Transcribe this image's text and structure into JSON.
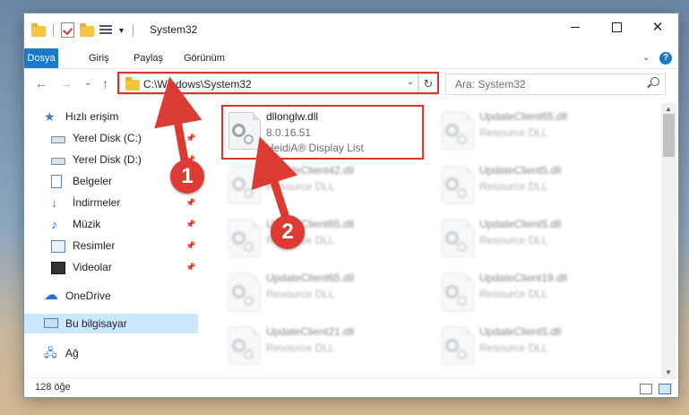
{
  "window": {
    "title": "System32",
    "controls": {
      "minimize": "minimize-icon",
      "maximize": "maximize-icon",
      "close": "✕"
    }
  },
  "ribbon": {
    "tabs": [
      "Dosya",
      "Giriş",
      "Paylaş",
      "Görünüm"
    ],
    "expand": "⌄",
    "help": "?"
  },
  "nav": {
    "back": "←",
    "forward": "→",
    "recent": "⌄",
    "up": "↑",
    "address": "C:\\Windows\\System32",
    "address_dropdown": "⌄",
    "refresh": "↻",
    "search_placeholder": "Ara: System32"
  },
  "sidebar": {
    "items": [
      {
        "label": "Hızlı erişim",
        "icon": "star-icon",
        "pinned": false
      },
      {
        "label": "Yerel Disk (C:)",
        "icon": "drive-icon",
        "pinned": true
      },
      {
        "label": "Yerel Disk (D:)",
        "icon": "drive-icon",
        "pinned": true
      },
      {
        "label": "Belgeler",
        "icon": "documents-icon",
        "pinned": true
      },
      {
        "label": "İndirmeler",
        "icon": "download-icon",
        "pinned": true
      },
      {
        "label": "Müzik",
        "icon": "music-icon",
        "pinned": true
      },
      {
        "label": "Resimler",
        "icon": "pictures-icon",
        "pinned": true
      },
      {
        "label": "Videolar",
        "icon": "videos-icon",
        "pinned": true
      },
      {
        "label": "OneDrive",
        "icon": "cloud-icon",
        "pinned": false
      },
      {
        "label": "Bu bilgisayar",
        "icon": "computer-icon",
        "pinned": false,
        "selected": true
      },
      {
        "label": "Ağ",
        "icon": "network-icon",
        "pinned": false
      }
    ],
    "pin_glyph": "📌"
  },
  "files": [
    {
      "name": "dllonglw.dll",
      "line1": "8.0.16.51",
      "line2": "HeidiA® Display List",
      "highlight": true
    },
    {
      "name": "UpdateClient65.dll",
      "line1": "Resource DLL"
    },
    {
      "name": "UpdateClient42.dll",
      "line1": "Resource DLL"
    },
    {
      "name": "UpdateClient5.dll",
      "line1": "Resource DLL"
    },
    {
      "name": "UpdateClient65.dll",
      "line1": "Resource DLL"
    },
    {
      "name": "UpdateClient5.dll",
      "line1": "Resource DLL"
    },
    {
      "name": "UpdateClient65.dll",
      "line1": "Resource DLL"
    },
    {
      "name": "UpdateClient19.dll",
      "line1": "Resource DLL"
    },
    {
      "name": "UpdateClient21.dll",
      "line1": "Resource DLL"
    },
    {
      "name": "UpdateClient5.dll",
      "line1": "Resource DLL"
    }
  ],
  "status": {
    "item_count": "128 öğe"
  },
  "annotations": {
    "badge1": "1",
    "badge2": "2",
    "color": "#dc3b33"
  }
}
